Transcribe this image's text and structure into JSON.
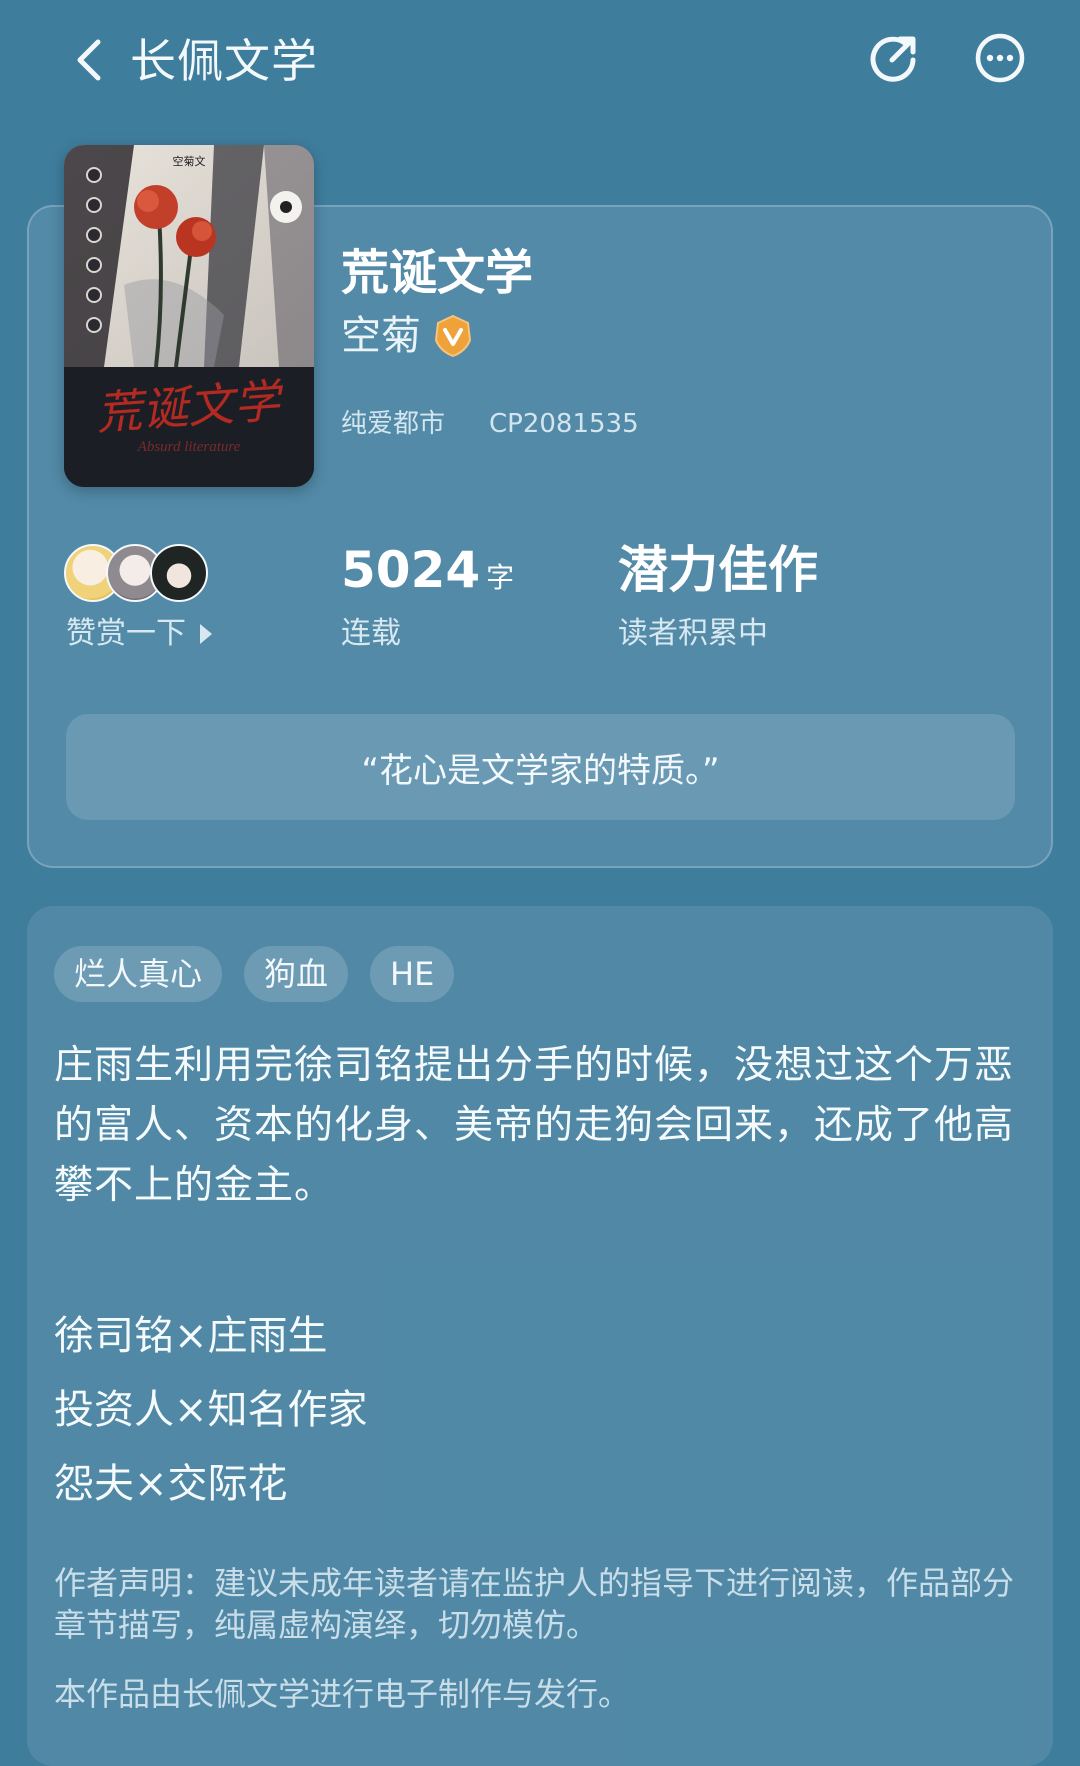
{
  "header": {
    "app_title": "长佩文学",
    "back_icon": "chevron-left-icon",
    "share_icon": "share-icon",
    "more_icon": "more-horizontal-icon"
  },
  "book": {
    "title": "荒诞文学",
    "author": "空菊",
    "author_badge": "verified-v-icon",
    "genre": "纯爱都市",
    "id": "CP2081535",
    "cover": {
      "top_text": "空菊文",
      "title_text": "荒诞文学",
      "subtitle_text": "Absurd literature"
    }
  },
  "stats": {
    "reward_label": "赞赏一下",
    "word_count": "5024",
    "word_unit": "字",
    "serial_status": "连载",
    "rank_title": "潜力佳作",
    "rank_sub": "读者积累中"
  },
  "quote": "“花心是文学家的特质。”",
  "tags": [
    "烂人真心",
    "狗血",
    "HE"
  ],
  "synopsis": "庄雨生利用完徐司铭提出分手的时候，没想过这个万恶的富人、资本的化身、美帝的走狗会回来，还成了他高攀不上的金主。",
  "pairings": [
    "徐司铭×庄雨生",
    "投资人×知名作家",
    "怨夫×交际花"
  ],
  "disclaimer": "作者声明：建议未成年读者请在监护人的指导下进行阅读，作品部分章节描写，纯属虚构演绎，切勿模仿。",
  "publisher_note": "本作品由长佩文学进行电子制作与发行。",
  "colors": {
    "background": "#3f7d9d",
    "badge": "#f0a23a"
  }
}
